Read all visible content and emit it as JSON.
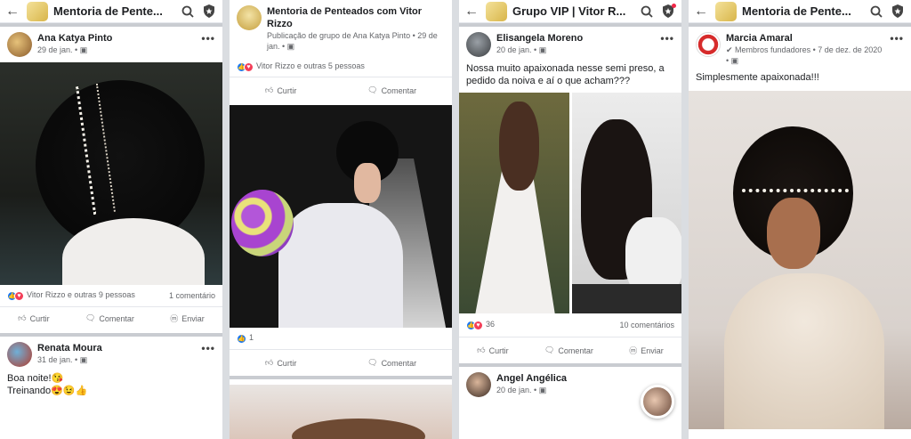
{
  "panel1": {
    "title": "Mentoria de Pente...",
    "post1": {
      "name": "Ana Katya Pinto",
      "meta": "29 de jan. • ",
      "reactions": "Vitor Rizzo e outras 9 pessoas",
      "comments": "1 comentário"
    },
    "actions": {
      "like": "Curtir",
      "comment": "Comentar",
      "send": "Enviar"
    },
    "post2": {
      "name": "Renata Moura",
      "meta": "31 de jan. • ",
      "line1": "Boa noite!😘",
      "line2": "Treinando😍😉👍"
    }
  },
  "panel2": {
    "name": "Mentoria de Penteados com Vitor Rizzo",
    "meta": "Publicação de grupo de Ana Katya Pinto • 29 de jan. • ",
    "reactions": "Vitor Rizzo e outras 5 pessoas",
    "actions": {
      "like": "Curtir",
      "comment": "Comentar"
    },
    "count2": "1",
    "actions2": {
      "like": "Curtir",
      "comment": "Comentar"
    }
  },
  "panel3": {
    "title": "Grupo VIP | Vitor R...",
    "post1": {
      "name": "Elisangela Moreno",
      "meta": "20 de jan. • ",
      "text": "Nossa muito apaixonada nesse semi preso, a pedido da noiva  e aí o que acham???",
      "reactions": "36",
      "comments": "10 comentários"
    },
    "actions": {
      "like": "Curtir",
      "comment": "Comentar",
      "send": "Enviar"
    },
    "post2": {
      "name": "Angel Angélica",
      "meta": "20 de jan. • "
    }
  },
  "panel4": {
    "title": "Mentoria de Pente...",
    "name": "Marcia Amaral",
    "meta": "✔ Membros fundadores • 7 de dez. de 2020 • ",
    "text": "Simplesmente apaixonada!!!"
  },
  "colors": {
    "accent": "#1877f2",
    "love": "#f33e58",
    "separator": "#c9ccd1"
  }
}
